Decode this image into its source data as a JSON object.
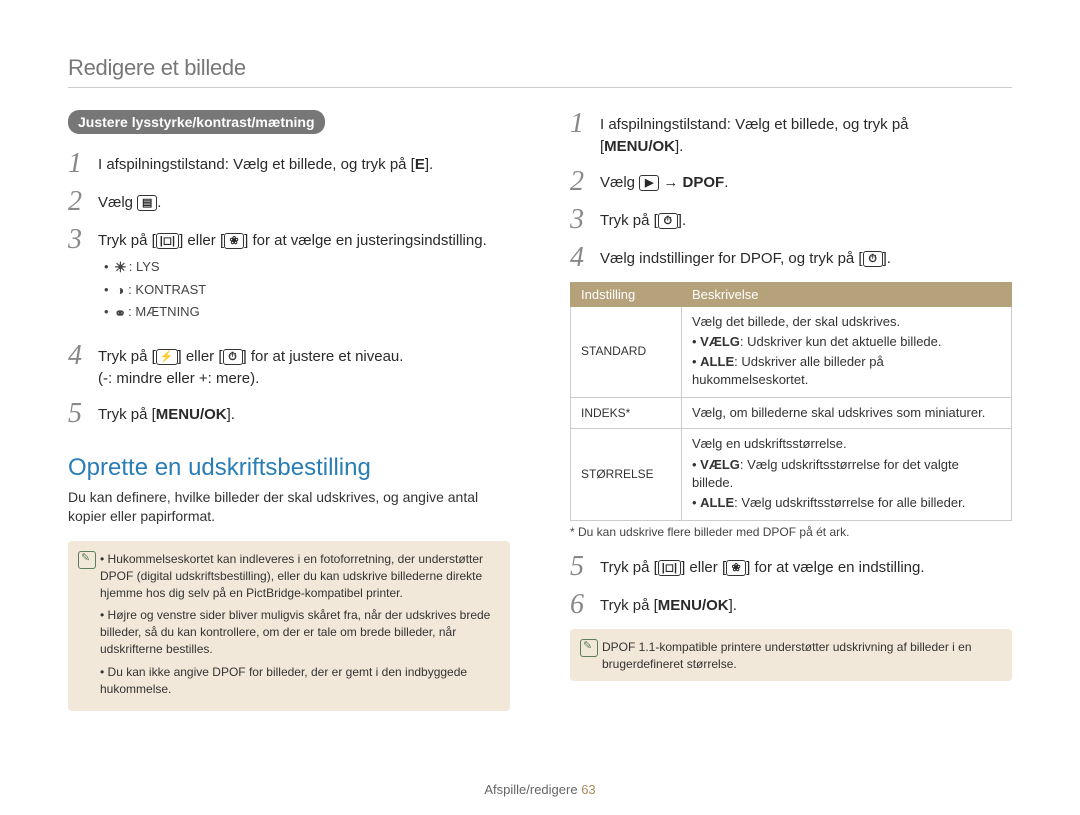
{
  "header": "Redigere et billede",
  "left": {
    "pill": "Justere lysstyrke/kontrast/mætning",
    "step1": {
      "pre": "I afspilningstilstand: Vælg et billede, og tryk på [",
      "key": "E",
      "post": "]."
    },
    "step2": {
      "pre": "Vælg ",
      "post": "."
    },
    "step3": {
      "pre1": "Tryk på [",
      "mid": "] eller [",
      "post": "] for at vælge en justeringsindstilling."
    },
    "sub": [
      "LYS",
      "KONTRAST",
      "MÆTNING"
    ],
    "step4": {
      "pre1": "Tryk på [",
      "mid": "] eller [",
      "post": "] for at justere et niveau.",
      "line2": "(-: mindre eller +: mere)."
    },
    "step5": {
      "pre": "Tryk på [",
      "key": "MENU/OK",
      "post": "]."
    },
    "sectionTitle": "Oprette en udskriftsbestilling",
    "sectionIntro": "Du kan definere, hvilke billeder der skal udskrives, og angive antal kopier eller papirformat.",
    "info": [
      "Hukommelseskortet kan indleveres i en fotoforretning, der understøtter DPOF (digital udskriftsbestilling), eller du kan udskrive billederne direkte hjemme hos dig selv på en PictBridge-kompatibel printer.",
      "Højre og venstre sider bliver muligvis skåret fra, når der udskrives brede billeder, så du kan kontrollere, om der er tale om brede billeder, når udskrifterne bestilles.",
      "Du kan ikke angive DPOF for billeder, der er gemt i den indbyggede hukommelse."
    ]
  },
  "right": {
    "step1": {
      "line1": "I afspilningstilstand: Vælg et billede, og tryk på",
      "pre2": "[",
      "key": "MENU/OK",
      "post2": "]."
    },
    "step2": {
      "pre": "Vælg ",
      "arrow": "→",
      "dpof": "DPOF",
      "post": "."
    },
    "step3": {
      "pre": "Tryk på [",
      "post": "]."
    },
    "step4": {
      "pre": "Vælg indstillinger for DPOF, og tryk på [",
      "post": "]."
    },
    "table": {
      "head": [
        "Indstilling",
        "Beskrivelse"
      ],
      "rows": [
        {
          "name": "STANDARD",
          "desc_lead": "Vælg det billede, der skal udskrives.",
          "bullets": [
            {
              "b": "VÆLG",
              "t": ": Udskriver kun det aktuelle billede."
            },
            {
              "b": "ALLE",
              "t": ": Udskriver alle billeder på hukommelseskortet."
            }
          ]
        },
        {
          "name": "INDEKS*",
          "desc_full": "Vælg, om billederne skal udskrives som miniaturer."
        },
        {
          "name": "STØRRELSE",
          "desc_lead": "Vælg en udskriftsstørrelse.",
          "bullets": [
            {
              "b": "VÆLG",
              "t": ": Vælg udskriftsstørrelse for det valgte billede."
            },
            {
              "b": "ALLE",
              "t": ": Vælg udskriftsstørrelse for alle billeder."
            }
          ]
        }
      ]
    },
    "footnote": "* Du kan udskrive flere billeder med DPOF på ét ark.",
    "step5": {
      "pre1": "Tryk på [",
      "mid": "] eller [",
      "post": "] for at vælge en indstilling."
    },
    "step6": {
      "pre": "Tryk på [",
      "key": "MENU/OK",
      "post": "]."
    },
    "info": "DPOF 1.1-kompatible printere understøtter udskrivning af billeder i en brugerdefineret størrelse."
  },
  "pagefoot": {
    "section": "Afspille/redigere",
    "num": "63"
  }
}
